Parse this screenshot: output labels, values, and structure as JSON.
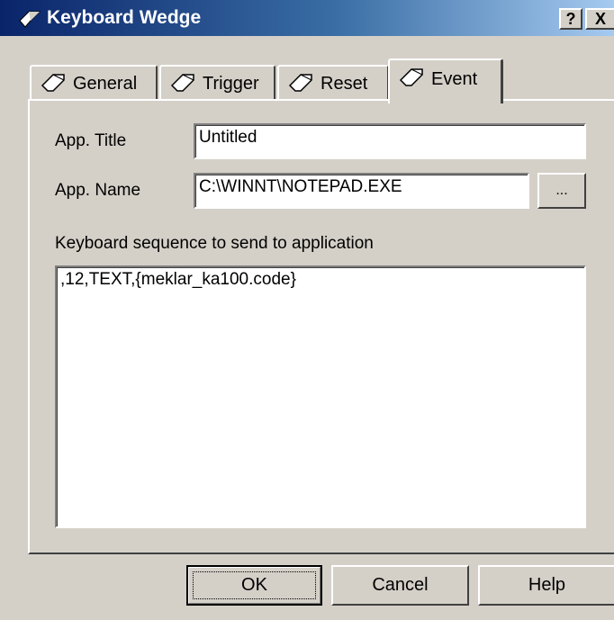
{
  "window": {
    "title": "Keyboard Wedge",
    "help_button": "?",
    "close_button": "X"
  },
  "tabs": [
    {
      "label": "General",
      "icon": "diamond-tag-icon",
      "selected": false
    },
    {
      "label": "Trigger",
      "icon": "diamond-tag-icon",
      "selected": false
    },
    {
      "label": "Reset",
      "icon": "diamond-tag-icon",
      "selected": false
    },
    {
      "label": "Event",
      "icon": "diamond-tag-icon",
      "selected": true
    }
  ],
  "form": {
    "app_title_label": "App. Title",
    "app_title_value": "Untitled",
    "app_name_label": "App. Name",
    "app_name_value": "C:\\WINNT\\NOTEPAD.EXE",
    "browse_label": "...",
    "sequence_label": "Keyboard sequence to send to application",
    "sequence_value": ",12,TEXT,{meklar_ka100.code}"
  },
  "buttons": {
    "ok": "OK",
    "cancel": "Cancel",
    "help": "Help"
  }
}
